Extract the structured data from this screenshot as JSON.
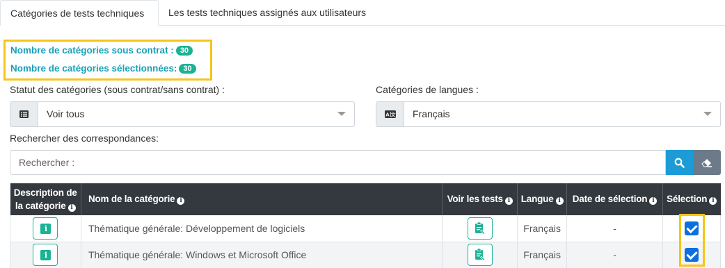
{
  "tabs": [
    {
      "label": "Catégories de tests techniques",
      "active": true
    },
    {
      "label": "Les tests techniques assignés aux utilisateurs",
      "active": false
    }
  ],
  "counts": {
    "under_contract_label": "Nombre de catégories sous contrat :",
    "under_contract_value": "30",
    "selected_label": "Nombre de catégories sélectionnées:",
    "selected_value": "30"
  },
  "filters": {
    "status_label": "Statut des catégories (sous contrat/sans contrat) :",
    "status_value": "Voir tous",
    "status_icon": "list-icon",
    "language_label": "Catégories de langues :",
    "language_value": "Français",
    "language_icon": "language-icon"
  },
  "search": {
    "label": "Rechercher des correspondances:",
    "placeholder": "Rechercher :",
    "search_icon": "search-icon",
    "clear_icon": "eraser-icon"
  },
  "table": {
    "headers": {
      "description_line1": "Description de",
      "description_line2": "la catégorie",
      "name": "Nom de la catégorie",
      "tests": "Voir les tests",
      "language": "Langue",
      "date": "Date de sélection",
      "selection": "Sélection"
    },
    "rows": [
      {
        "name": "Thématique générale: Développement de logiciels",
        "language": "Français",
        "date": "-",
        "selected": true
      },
      {
        "name": "Thématique générale: Windows et Microsoft Office",
        "language": "Français",
        "date": "-",
        "selected": true
      }
    ]
  },
  "colors": {
    "accent": "#17a2b8",
    "badge": "#1ab394",
    "header_bg": "#34393f",
    "highlight": "#f5c518",
    "search_button": "#1c9bd6",
    "clear_button": "#6c7a89"
  }
}
